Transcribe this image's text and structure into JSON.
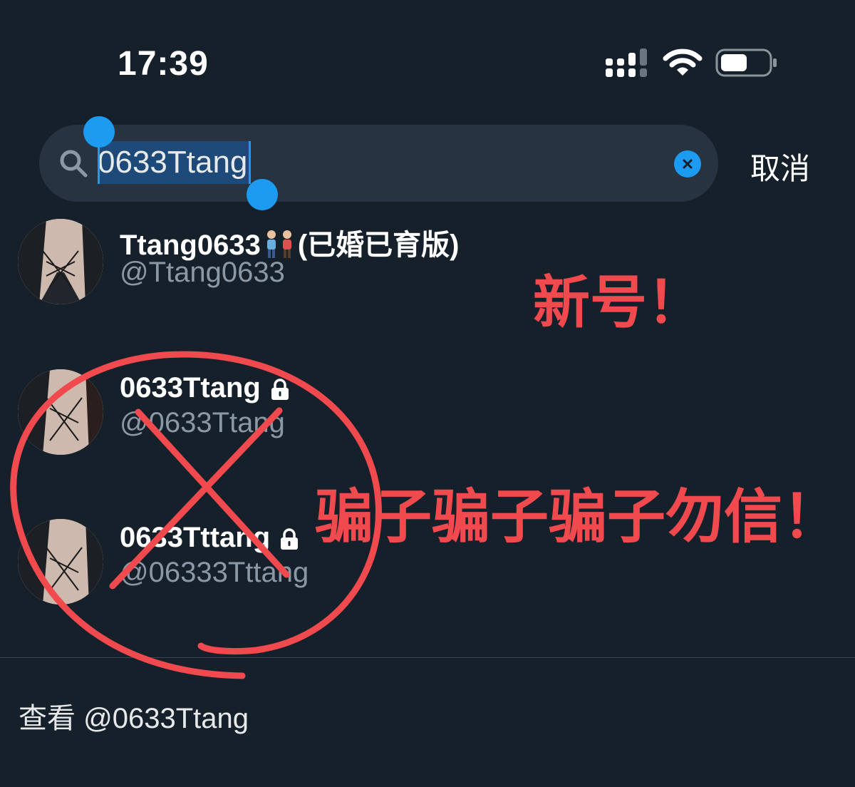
{
  "status_bar": {
    "time": "17:39"
  },
  "search": {
    "value": "0633Ttang",
    "cancel_label": "取消"
  },
  "results": [
    {
      "name": "Ttang0633",
      "name_suffix": "(已婚已育版)",
      "handle": "@Ttang0633",
      "locked": false
    },
    {
      "name": "0633Ttang",
      "handle": "@0633Ttang",
      "locked": true
    },
    {
      "name": "0633Tttang",
      "handle": "@06333Tttang",
      "locked": true
    }
  ],
  "footer": {
    "view_label": "查看 @0633Ttang"
  },
  "annotations": {
    "new_account": "新号！",
    "scam_warning": "骗子骗子骗子勿信！",
    "color": "#f04a4f"
  },
  "colors": {
    "background": "#15202b",
    "accent": "#1d9bf0",
    "secondary_text": "#8b98a5"
  }
}
